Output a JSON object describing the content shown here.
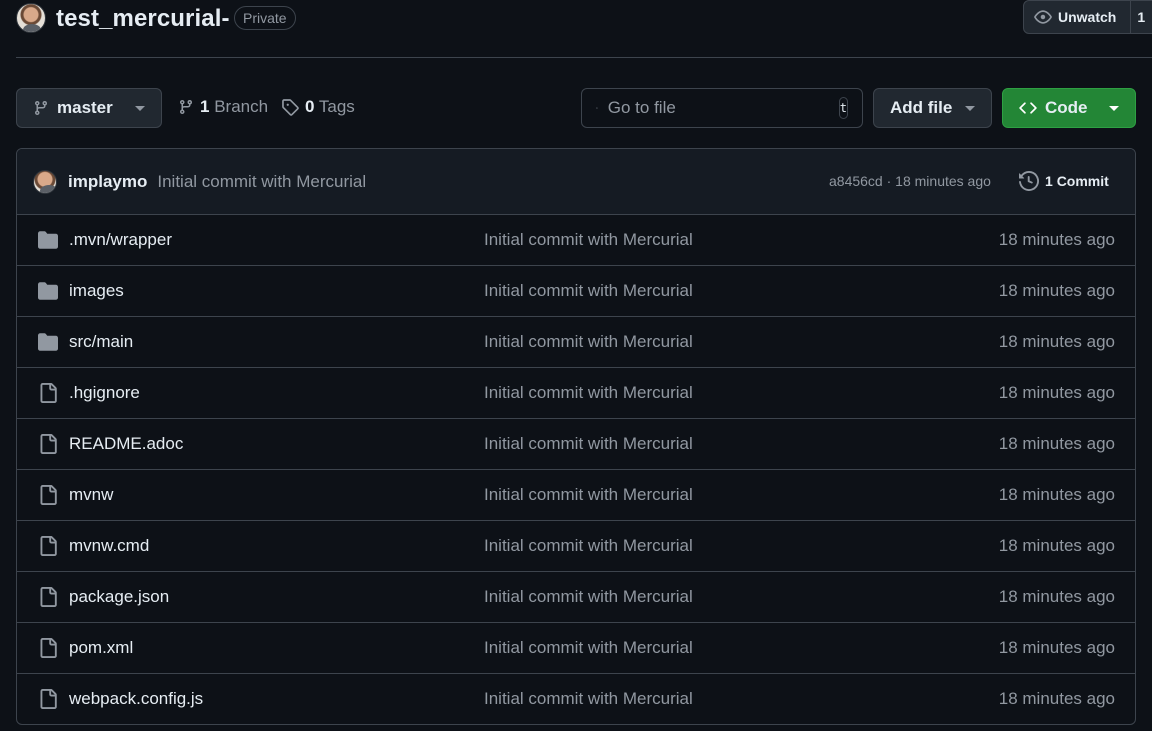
{
  "repo": {
    "title": "test_mercurial-",
    "visibility": "Private",
    "watch_label": "Unwatch",
    "watch_count": "1"
  },
  "toolbar": {
    "branch_name": "master",
    "branches_count": "1",
    "branches_label": "Branch",
    "tags_count": "0",
    "tags_label": "Tags",
    "search_placeholder": "Go to file",
    "search_shortcut": "t",
    "add_file_label": "Add file",
    "code_label": "Code",
    "accent_color": "#238636"
  },
  "latest_commit": {
    "author": "implaymo",
    "message": "Initial commit with Mercurial",
    "hash": "a8456cd",
    "time": "18 minutes ago",
    "commits_count": "1",
    "commits_label": "Commit"
  },
  "files": [
    {
      "name": ".mvn/wrapper",
      "type": "folder",
      "commit": "Initial commit with Mercurial",
      "time": "18 minutes ago"
    },
    {
      "name": "images",
      "type": "folder",
      "commit": "Initial commit with Mercurial",
      "time": "18 minutes ago"
    },
    {
      "name": "src/main",
      "type": "folder",
      "commit": "Initial commit with Mercurial",
      "time": "18 minutes ago"
    },
    {
      "name": ".hgignore",
      "type": "file",
      "commit": "Initial commit with Mercurial",
      "time": "18 minutes ago"
    },
    {
      "name": "README.adoc",
      "type": "file",
      "commit": "Initial commit with Mercurial",
      "time": "18 minutes ago"
    },
    {
      "name": "mvnw",
      "type": "file",
      "commit": "Initial commit with Mercurial",
      "time": "18 minutes ago"
    },
    {
      "name": "mvnw.cmd",
      "type": "file",
      "commit": "Initial commit with Mercurial",
      "time": "18 minutes ago"
    },
    {
      "name": "package.json",
      "type": "file",
      "commit": "Initial commit with Mercurial",
      "time": "18 minutes ago"
    },
    {
      "name": "pom.xml",
      "type": "file",
      "commit": "Initial commit with Mercurial",
      "time": "18 minutes ago"
    },
    {
      "name": "webpack.config.js",
      "type": "file",
      "commit": "Initial commit with Mercurial",
      "time": "18 minutes ago"
    }
  ]
}
